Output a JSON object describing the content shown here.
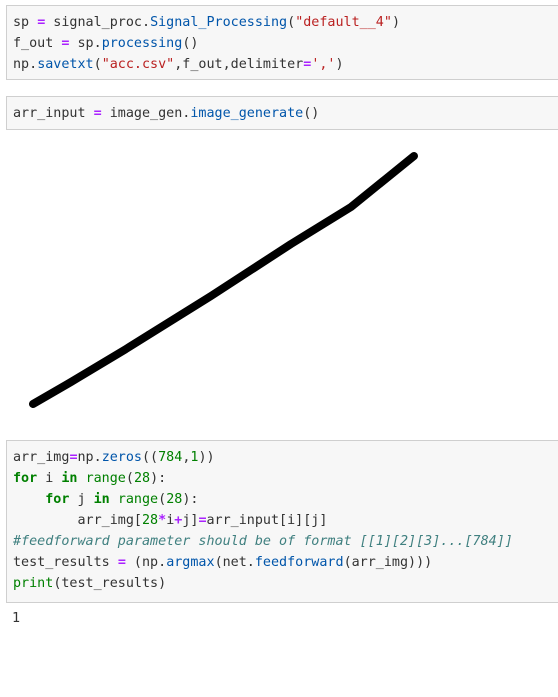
{
  "cells": [
    {
      "lines": [
        [
          {
            "t": "sp",
            "c": "plain"
          },
          {
            "t": " ",
            "c": "plain"
          },
          {
            "t": "=",
            "c": "op"
          },
          {
            "t": " signal_proc.",
            "c": "plain"
          },
          {
            "t": "Signal_Processing",
            "c": "fn"
          },
          {
            "t": "(",
            "c": "plain"
          },
          {
            "t": "\"default__4\"",
            "c": "str"
          },
          {
            "t": ")",
            "c": "plain"
          }
        ],
        [
          {
            "t": "f_out",
            "c": "plain"
          },
          {
            "t": " ",
            "c": "plain"
          },
          {
            "t": "=",
            "c": "op"
          },
          {
            "t": " sp.",
            "c": "plain"
          },
          {
            "t": "processing",
            "c": "fn"
          },
          {
            "t": "()",
            "c": "plain"
          }
        ],
        [
          {
            "t": "np.",
            "c": "plain"
          },
          {
            "t": "savetxt",
            "c": "fn"
          },
          {
            "t": "(",
            "c": "plain"
          },
          {
            "t": "\"acc.csv\"",
            "c": "str"
          },
          {
            "t": ",f_out,delimiter",
            "c": "plain"
          },
          {
            "t": "=",
            "c": "op"
          },
          {
            "t": "','",
            "c": "str"
          },
          {
            "t": ")",
            "c": "plain"
          }
        ]
      ]
    },
    {
      "lines": [
        [
          {
            "t": "arr_input",
            "c": "plain"
          },
          {
            "t": " ",
            "c": "plain"
          },
          {
            "t": "=",
            "c": "op"
          },
          {
            "t": " image_gen.",
            "c": "plain"
          },
          {
            "t": "image_generate",
            "c": "fn"
          },
          {
            "t": "()",
            "c": "plain"
          }
        ]
      ]
    },
    {
      "lines": [
        [
          {
            "t": "arr_img",
            "c": "plain"
          },
          {
            "t": "=",
            "c": "op"
          },
          {
            "t": "np.",
            "c": "plain"
          },
          {
            "t": "zeros",
            "c": "fn"
          },
          {
            "t": "((",
            "c": "plain"
          },
          {
            "t": "784",
            "c": "num"
          },
          {
            "t": ",",
            "c": "plain"
          },
          {
            "t": "1",
            "c": "num"
          },
          {
            "t": "))",
            "c": "plain"
          }
        ],
        [
          {
            "t": "for",
            "c": "kw"
          },
          {
            "t": " i ",
            "c": "plain"
          },
          {
            "t": "in",
            "c": "kw"
          },
          {
            "t": " ",
            "c": "plain"
          },
          {
            "t": "range",
            "c": "bi"
          },
          {
            "t": "(",
            "c": "plain"
          },
          {
            "t": "28",
            "c": "num"
          },
          {
            "t": "):",
            "c": "plain"
          }
        ],
        [
          {
            "t": "    ",
            "c": "plain"
          },
          {
            "t": "for",
            "c": "kw"
          },
          {
            "t": " j ",
            "c": "plain"
          },
          {
            "t": "in",
            "c": "kw"
          },
          {
            "t": " ",
            "c": "plain"
          },
          {
            "t": "range",
            "c": "bi"
          },
          {
            "t": "(",
            "c": "plain"
          },
          {
            "t": "28",
            "c": "num"
          },
          {
            "t": "):",
            "c": "plain"
          }
        ],
        [
          {
            "t": "        arr_img[",
            "c": "plain"
          },
          {
            "t": "28",
            "c": "num"
          },
          {
            "t": "*",
            "c": "op"
          },
          {
            "t": "i",
            "c": "plain"
          },
          {
            "t": "+",
            "c": "op"
          },
          {
            "t": "j]",
            "c": "plain"
          },
          {
            "t": "=",
            "c": "op"
          },
          {
            "t": "arr_input[i][j]",
            "c": "plain"
          }
        ],
        [
          {
            "t": "#feedforward parameter should be of format [[1][2][3]...[784]]",
            "c": "cm"
          }
        ],
        [
          {
            "t": "test_results",
            "c": "plain"
          },
          {
            "t": " ",
            "c": "plain"
          },
          {
            "t": "=",
            "c": "op"
          },
          {
            "t": " (np.",
            "c": "plain"
          },
          {
            "t": "argmax",
            "c": "fn"
          },
          {
            "t": "(net.",
            "c": "plain"
          },
          {
            "t": "feedforward",
            "c": "fn"
          },
          {
            "t": "(arr_img)))",
            "c": "plain"
          }
        ],
        [
          {
            "t": "print",
            "c": "bi"
          },
          {
            "t": "(test_results)",
            "c": "plain"
          }
        ]
      ]
    }
  ],
  "output": {
    "result": "1",
    "stroke_color": "#000000"
  }
}
